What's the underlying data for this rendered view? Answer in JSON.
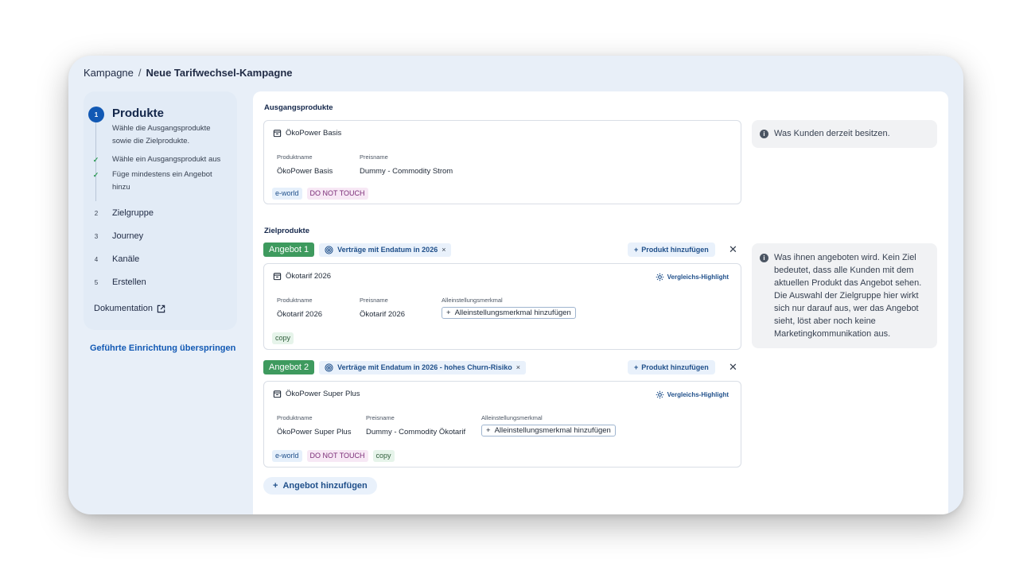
{
  "breadcrumb": {
    "root": "Kampagne",
    "separator": "/",
    "current": "Neue Tarifwechsel-Kampagne"
  },
  "sidebar": {
    "active_step": {
      "number": "1",
      "title": "Produkte",
      "description": "Wähle die Ausgangsprodukte sowie die Zielprodukte.",
      "tasks": [
        "Wähle ein Ausgangsprodukt aus",
        "Füge mindestens ein Angebot hinzu"
      ]
    },
    "steps": [
      {
        "number": "2",
        "label": "Zielgruppe"
      },
      {
        "number": "3",
        "label": "Journey"
      },
      {
        "number": "4",
        "label": "Kanäle"
      },
      {
        "number": "5",
        "label": "Erstellen"
      }
    ],
    "docs_label": "Dokumentation",
    "skip_label": "Geführte Einrichtung überspringen"
  },
  "source": {
    "section_title": "Ausgangsprodukte",
    "product": "ÖkoPower Basis",
    "col_product_label": "Produktname",
    "col_product_value": "ÖkoPower Basis",
    "col_price_label": "Preisname",
    "col_price_value": "Dummy - Commodity Strom",
    "tags": [
      "e-world",
      "DO NOT TOUCH"
    ],
    "info": "Was Kunden derzeit besitzen."
  },
  "target": {
    "section_title": "Zielprodukte",
    "info": "Was ihnen angeboten wird. Kein Ziel bedeutet, dass alle Kunden mit dem aktuellen Produkt das Angebot sehen. Die Auswahl der Zielgruppe hier wirkt sich nur darauf aus, wer das Angebot sieht, löst aber noch keine Marketingkommunikation aus.",
    "add_product_label": "Produkt hinzufügen",
    "compare_label": "Vergleichs-Highlight",
    "usp_col_label": "Alleinstellungsmerkmal",
    "usp_add_label": "Alleinstellungsmerkmal hinzufügen",
    "offers": [
      {
        "badge": "Angebot 1",
        "chip": "Verträge mit Endatum in 2026",
        "product": "Ökotarif 2026",
        "col_product_label": "Produktname",
        "col_product_value": "Ökotarif 2026",
        "col_price_label": "Preisname",
        "col_price_value": "Ökotarif 2026",
        "tags": [
          "copy"
        ]
      },
      {
        "badge": "Angebot 2",
        "chip": "Verträge mit Endatum in 2026 - hohes Churn-Risiko",
        "product": "ÖkoPower Super Plus",
        "col_product_label": "Produktname",
        "col_product_value": "ÖkoPower Super Plus",
        "col_price_label": "Preisname",
        "col_price_value": "Dummy - Commodity Ökotarif",
        "tags": [
          "e-world",
          "DO NOT TOUCH",
          "copy"
        ]
      }
    ],
    "add_offer_label": "Angebot hinzufügen"
  }
}
